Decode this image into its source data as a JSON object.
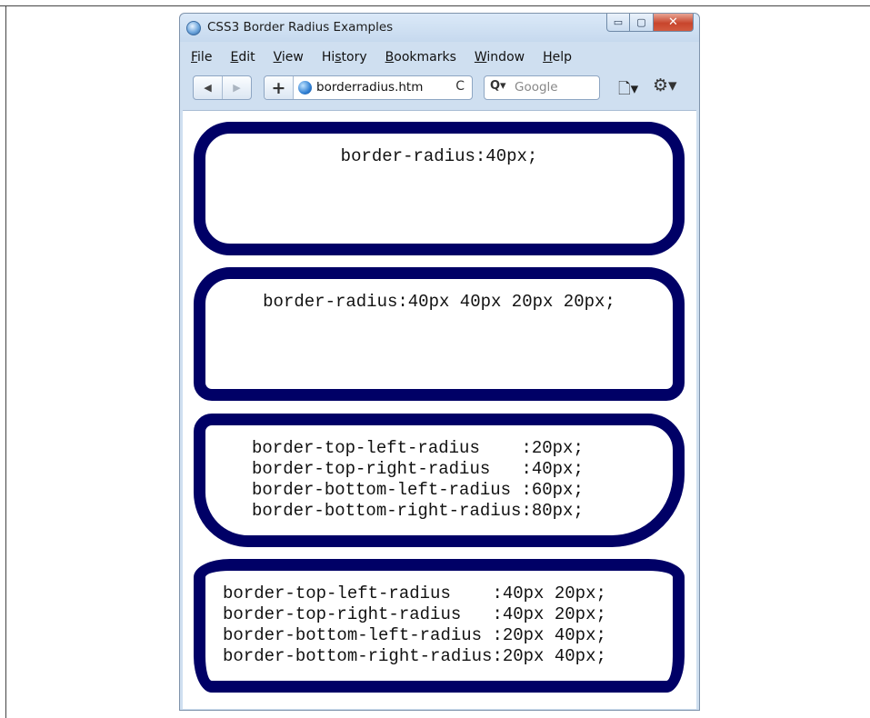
{
  "window": {
    "title": "CSS3 Border Radius Examples",
    "minimize": "▭",
    "maximize": "▢",
    "close": "✕"
  },
  "menu": {
    "items": [
      {
        "u": "F",
        "rest": "ile"
      },
      {
        "u": "E",
        "rest": "dit"
      },
      {
        "u": "V",
        "rest": "iew"
      },
      {
        "pre": "Hi",
        "u": "s",
        "rest": "tory"
      },
      {
        "u": "B",
        "rest": "ookmarks"
      },
      {
        "u": "W",
        "rest": "indow"
      },
      {
        "u": "H",
        "rest": "elp"
      }
    ]
  },
  "nav": {
    "back": "◀",
    "forward": "▶",
    "new_tab": "+",
    "address": "borderradius.htm",
    "reload": "C",
    "search_icon": "Q▾",
    "search_placeholder": "Google",
    "page_menu": "🗋▾",
    "tools_menu": "⚙▾"
  },
  "boxes": [
    {
      "text": "border-radius:40px;"
    },
    {
      "text": "border-radius:40px 40px 20px 20px;"
    },
    {
      "text": "border-top-left-radius    :20px;\nborder-top-right-radius   :40px;\nborder-bottom-left-radius :60px;\nborder-bottom-right-radius:80px;"
    },
    {
      "text": "border-top-left-radius    :40px 20px;\nborder-top-right-radius   :40px 20px;\nborder-bottom-left-radius :20px 40px;\nborder-bottom-right-radius:20px 40px;"
    }
  ],
  "colors": {
    "box_border": "#000066"
  }
}
